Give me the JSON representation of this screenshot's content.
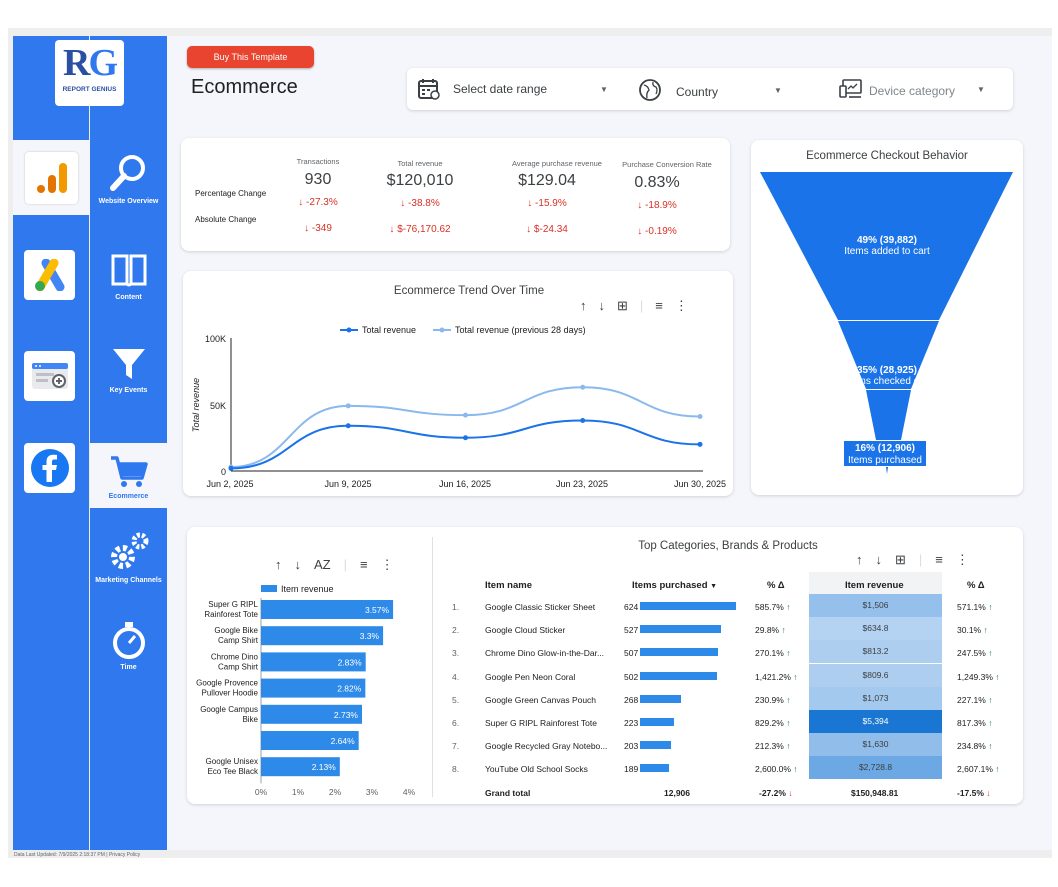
{
  "brand": {
    "logo_letters": "RG",
    "logo_sub": "REPORT GENIUS"
  },
  "apps": [
    "google-analytics-icon",
    "google-ads-icon",
    "search-console-icon",
    "facebook-icon"
  ],
  "nav": [
    {
      "label": "Website Overview",
      "icon": "magnifier-icon"
    },
    {
      "label": "Content",
      "icon": "book-icon"
    },
    {
      "label": "Key Events",
      "icon": "funnel-icon"
    },
    {
      "label": "Ecommerce",
      "icon": "cart-icon",
      "active": true
    },
    {
      "label": "Marketing Channels",
      "icon": "gears-icon"
    },
    {
      "label": "Time",
      "icon": "stopwatch-icon"
    }
  ],
  "header": {
    "buy_label": "Buy This Template",
    "title": "Ecommerce"
  },
  "filters": {
    "date": "Select date range",
    "country": "Country",
    "device": "Device category"
  },
  "kpis": {
    "row1_label": "Percentage Change",
    "row2_label": "Absolute Change",
    "items": [
      {
        "label": "Transactions",
        "value": "930",
        "pct": "-27.3%",
        "abs": "-349"
      },
      {
        "label": "Total revenue",
        "value": "$120,010",
        "pct": "-38.8%",
        "abs": "$-76,170.62"
      },
      {
        "label": "Average purchase revenue",
        "value": "$129.04",
        "pct": "-15.9%",
        "abs": "$-24.34"
      },
      {
        "label": "Purchase Conversion Rate",
        "value": "0.83%",
        "pct": "-18.9%",
        "abs": "-0.19%"
      }
    ]
  },
  "funnel": {
    "title": "Ecommerce Checkout Behavior",
    "stages": [
      {
        "pct": "49% (39,882)",
        "label": "Items added to cart"
      },
      {
        "pct": "35% (28,925)",
        "label": "Items checked out"
      },
      {
        "pct": "16% (12,906)",
        "label": "Items purchased"
      }
    ]
  },
  "trend": {
    "title": "Ecommerce Trend Over Time",
    "ylabel": "Total revenue",
    "legend": [
      "Total revenue",
      "Total revenue (previous 28 days)"
    ],
    "yticks": [
      "100K",
      "50K",
      "0"
    ],
    "xticks": [
      "Jun 2, 2025",
      "Jun 9, 2025",
      "Jun 16, 2025",
      "Jun 23, 2025",
      "Jun 30, 2025"
    ]
  },
  "chart_data": [
    {
      "type": "line",
      "x": [
        "Jun 2, 2025",
        "Jun 9, 2025",
        "Jun 16, 2025",
        "Jun 23, 2025",
        "Jun 30, 2025"
      ],
      "series": [
        {
          "name": "Total revenue",
          "values": [
            2000,
            34000,
            25000,
            38000,
            20000
          ],
          "color": "#1a73e8"
        },
        {
          "name": "Total revenue (previous 28 days)",
          "values": [
            3000,
            49000,
            42000,
            63000,
            41000
          ],
          "color": "#8ab9ee"
        }
      ],
      "ylim": [
        0,
        100000
      ],
      "ylabel": "Total revenue"
    },
    {
      "type": "bar",
      "legend": "Item revenue",
      "categories": [
        "Super G RIPL Rainforest Tote",
        "Google Bike Camp Shirt",
        "Chrome Dino Camp Shirt",
        "Google Provence Pullover Hoodie",
        "Google Campus Bike",
        "",
        "Google Unisex Eco Tee Black"
      ],
      "values": [
        3.57,
        3.3,
        2.83,
        2.82,
        2.73,
        2.64,
        2.13
      ],
      "labels": [
        "3.57%",
        "3.3%",
        "2.83%",
        "2.82%",
        "2.73%",
        "2.64%",
        "2.13%"
      ],
      "xticks": [
        "0%",
        "1%",
        "2%",
        "3%",
        "4%"
      ],
      "xlim": [
        0,
        4
      ]
    }
  ],
  "bar_labels": [
    [
      "Super G RIPL",
      "Rainforest Tote"
    ],
    [
      "Google Bike",
      "Camp Shirt"
    ],
    [
      "Chrome Dino",
      "Camp Shirt"
    ],
    [
      "Google Provence",
      "Pullover Hoodie"
    ],
    [
      "Google Campus",
      "Bike"
    ],
    [
      "",
      ""
    ],
    [
      "Google Unisex",
      "Eco Tee Black"
    ]
  ],
  "table": {
    "title": "Top Categories, Brands & Products",
    "headers": {
      "name": "Item name",
      "purchased": "Items purchased",
      "pct1": "% Δ",
      "revenue": "Item revenue",
      "pct2": "% Δ"
    },
    "rows": [
      {
        "n": "1.",
        "name": "Google Classic Sticker Sheet",
        "qty": "624",
        "q": 624,
        "pct": "585.7%",
        "rev": "$1,506",
        "pct2": "571.1%"
      },
      {
        "n": "2.",
        "name": "Google Cloud Sticker",
        "qty": "527",
        "q": 527,
        "pct": "29.8%",
        "rev": "$634.8",
        "pct2": "30.1%"
      },
      {
        "n": "3.",
        "name": "Chrome Dino Glow-in-the-Dar...",
        "qty": "507",
        "q": 507,
        "pct": "270.1%",
        "rev": "$813.2",
        "pct2": "247.5%"
      },
      {
        "n": "4.",
        "name": "Google Pen Neon Coral",
        "qty": "502",
        "q": 502,
        "pct": "1,421.2%",
        "rev": "$809.6",
        "pct2": "1,249.3%"
      },
      {
        "n": "5.",
        "name": "Google Green Canvas Pouch",
        "qty": "268",
        "q": 268,
        "pct": "230.9%",
        "rev": "$1,073",
        "pct2": "227.1%"
      },
      {
        "n": "6.",
        "name": "Super G RIPL Rainforest Tote",
        "qty": "223",
        "q": 223,
        "pct": "829.2%",
        "rev": "$5,394",
        "pct2": "817.3%"
      },
      {
        "n": "7.",
        "name": "Google Recycled Gray Notebo...",
        "qty": "203",
        "q": 203,
        "pct": "212.3%",
        "rev": "$1,630",
        "pct2": "234.8%"
      },
      {
        "n": "8.",
        "name": "YouTube Old School Socks",
        "qty": "189",
        "q": 189,
        "pct": "2,600.0%",
        "rev": "$2,728.8",
        "pct2": "2,607.1%"
      }
    ],
    "total": {
      "label": "Grand total",
      "qty": "12,906",
      "pct": "-27.2%",
      "rev": "$150,948.81",
      "pct2": "-17.5%"
    }
  },
  "footer": "Data Last Updated: 7/9/2025 2:18:37 PM  |  Privacy Policy"
}
